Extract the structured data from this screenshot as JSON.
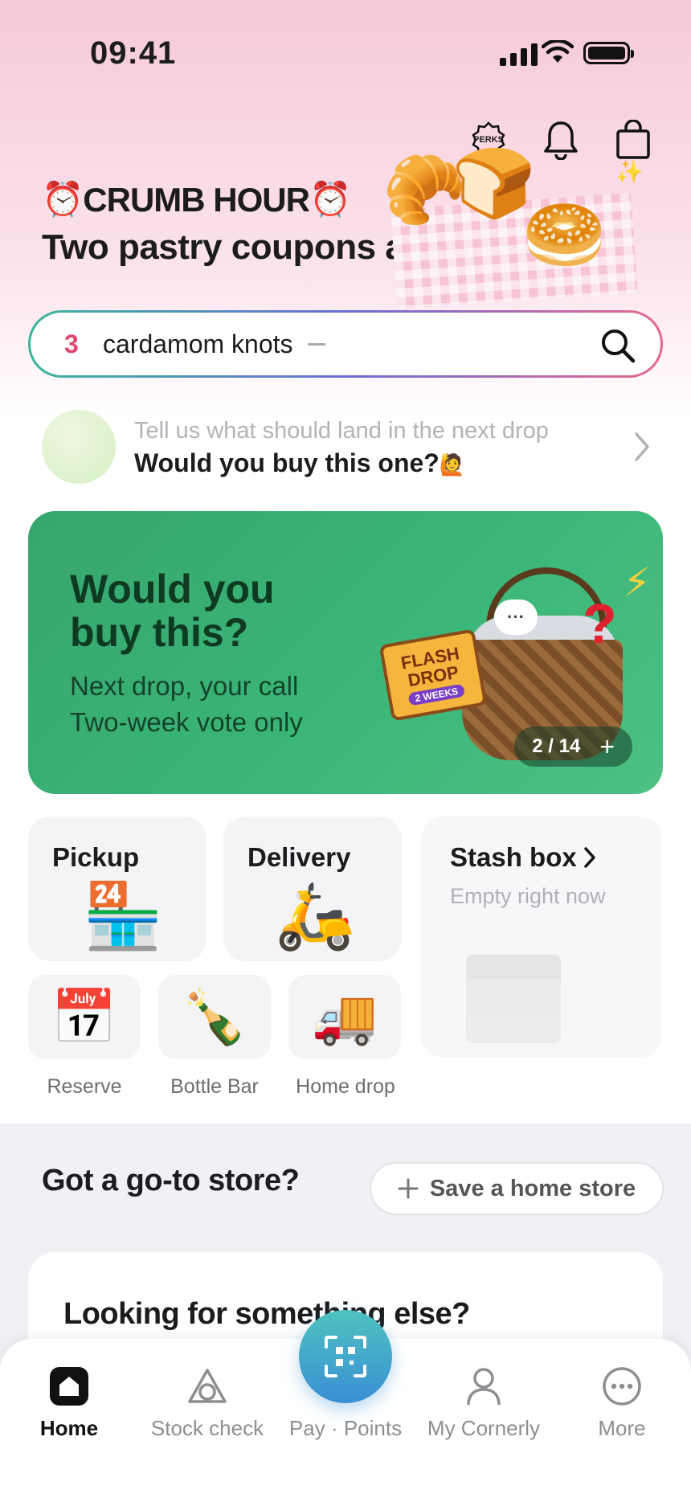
{
  "status_bar": {
    "time": "09:41"
  },
  "header": {
    "perks_label": "PERKS",
    "promo_title": "CRUMB HOUR",
    "promo_emoji": "⏰",
    "promo_subtitle": "Two pastry coupons a day! ›"
  },
  "search": {
    "rank": "3",
    "text": "cardamom knots"
  },
  "poll": {
    "subtitle": "Tell us what should land in the next drop",
    "title": "Would you buy this one?",
    "emoji": "🙋"
  },
  "banner": {
    "title": "Would you buy this?",
    "line1": "Next drop, your call",
    "line2": "Two-week vote only",
    "badge_line1": "FLASH",
    "badge_line2": "DROP",
    "badge_weeks": "2 WEEKS",
    "pager": "2 / 14",
    "pager_plus": "+",
    "bubble": "···",
    "question": "?",
    "bolt": "⚡",
    "background": "#3ab679"
  },
  "tiles": {
    "pickup": "Pickup",
    "delivery": "Delivery",
    "stash_title": "Stash box",
    "stash_sub": "Empty right now"
  },
  "small_tiles": [
    {
      "label": "Reserve",
      "emoji": "📅"
    },
    {
      "label": "Bottle Bar",
      "emoji": "🍾"
    },
    {
      "label": "Home drop",
      "emoji": "🚚"
    }
  ],
  "store": {
    "title": "Got a go-to store?",
    "save_label": "Save a home store"
  },
  "looking": {
    "title": "Looking for something else?"
  },
  "tabbar": {
    "home": "Home",
    "stock_check": "Stock check",
    "pay_points": "Pay · Points",
    "my": "My Cornerly",
    "more": "More"
  },
  "colors": {
    "accent_pink": "#e0496f",
    "fab": "#3a8fd4",
    "green": "#3ab679"
  }
}
